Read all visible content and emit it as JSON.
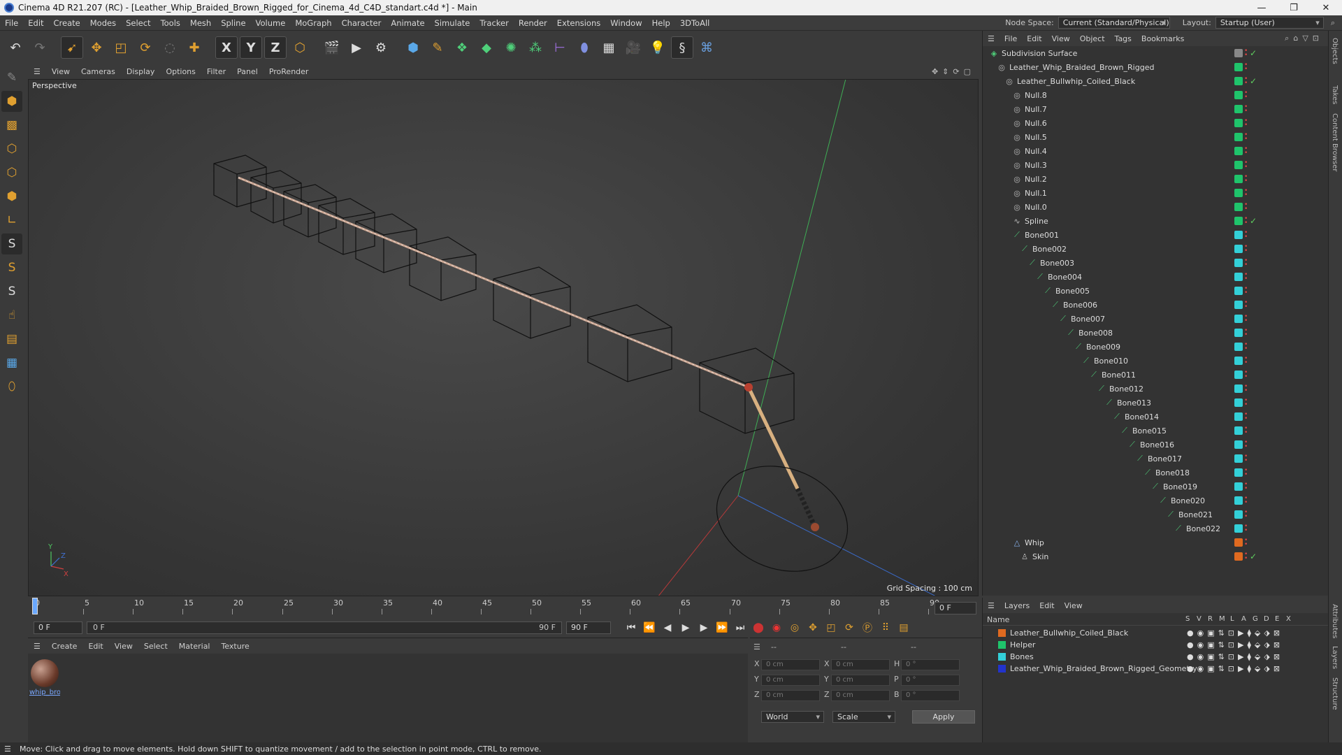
{
  "window": {
    "title": "Cinema 4D R21.207 (RC) - [Leather_Whip_Braided_Brown_Rigged_for_Cinema_4d_C4D_standart.c4d *] - Main",
    "minimize": "—",
    "maximize": "❐",
    "close": "✕"
  },
  "menubar": {
    "items": [
      "File",
      "Edit",
      "Create",
      "Modes",
      "Select",
      "Tools",
      "Mesh",
      "Spline",
      "Volume",
      "MoGraph",
      "Character",
      "Animate",
      "Simulate",
      "Tracker",
      "Render",
      "Extensions",
      "Window",
      "Help",
      "3DToAll"
    ],
    "node_space_label": "Node Space:",
    "node_space_value": "Current (Standard/Physical)",
    "layout_label": "Layout:",
    "layout_value": "Startup (User)"
  },
  "toolbar": {
    "icons": [
      "undo-icon",
      "redo-icon",
      "select-icon",
      "move-icon",
      "scale-icon",
      "rotate-icon",
      "live-select-icon",
      "create-icon",
      "x-axis-icon",
      "y-axis-icon",
      "z-axis-icon",
      "coordinate-system-icon",
      "render-view-icon",
      "render-picture-viewer-icon",
      "render-settings-icon",
      "cube-icon",
      "pen-icon",
      "subdivision-icon",
      "extrude-icon",
      "cloner-icon",
      "mograph-icon",
      "measure-icon",
      "deformer-icon",
      "floor-icon",
      "camera-icon",
      "light-icon",
      "spline-tool-icon",
      "python-icon"
    ],
    "axis_x": "X",
    "axis_y": "Y",
    "axis_z": "Z"
  },
  "viewport": {
    "menu": [
      "View",
      "Cameras",
      "Display",
      "Options",
      "Filter",
      "Panel",
      "ProRender"
    ],
    "label": "Perspective",
    "grid_spacing": "Grid Spacing : 100 cm",
    "axis_labels": {
      "y": "Y",
      "x": "X",
      "z": "Z"
    }
  },
  "timeline": {
    "ticks": [
      "0",
      "5",
      "10",
      "15",
      "20",
      "25",
      "30",
      "35",
      "40",
      "45",
      "50",
      "55",
      "60",
      "65",
      "70",
      "75",
      "80",
      "85",
      "90"
    ],
    "current_frame_display": "0 F",
    "start_field": "0 F",
    "range_start": "0 F",
    "range_end": "90 F",
    "end_field": "90 F"
  },
  "material_manager": {
    "menu": [
      "Create",
      "Edit",
      "View",
      "Select",
      "Material",
      "Texture"
    ],
    "materials": [
      {
        "name": "whip_bro"
      }
    ]
  },
  "coordinates": {
    "header_left": "--",
    "header_mid": "--",
    "header_right": "--",
    "rows": [
      {
        "axis": "X",
        "pos": "0 cm",
        "axis2": "X",
        "size": "0 cm",
        "axis3": "H",
        "rot": "0 °"
      },
      {
        "axis": "Y",
        "pos": "0 cm",
        "axis2": "Y",
        "size": "0 cm",
        "axis3": "P",
        "rot": "0 °"
      },
      {
        "axis": "Z",
        "pos": "0 cm",
        "axis2": "Z",
        "size": "0 cm",
        "axis3": "B",
        "rot": "0 °"
      }
    ],
    "mode": "World",
    "mode2": "Scale",
    "apply": "Apply"
  },
  "object_manager": {
    "menu": [
      "File",
      "Edit",
      "View",
      "Object",
      "Tags",
      "Bookmarks"
    ],
    "objects": [
      {
        "name": "Subdivision Surface",
        "indent": 0,
        "icon": "subdivision-icon",
        "color": "#888888",
        "check": true
      },
      {
        "name": "Leather_Whip_Braided_Brown_Rigged",
        "indent": 1,
        "icon": "null-icon",
        "color": "#1fc46b",
        "check": false
      },
      {
        "name": "Leather_Bullwhip_Coiled_Black",
        "indent": 2,
        "icon": "null-icon",
        "color": "#1fc46b",
        "check": true
      },
      {
        "name": "Null.8",
        "indent": 3,
        "icon": "null-icon",
        "color": "#1fc46b"
      },
      {
        "name": "Null.7",
        "indent": 3,
        "icon": "null-icon",
        "color": "#1fc46b"
      },
      {
        "name": "Null.6",
        "indent": 3,
        "icon": "null-icon",
        "color": "#1fc46b"
      },
      {
        "name": "Null.5",
        "indent": 3,
        "icon": "null-icon",
        "color": "#1fc46b"
      },
      {
        "name": "Null.4",
        "indent": 3,
        "icon": "null-icon",
        "color": "#1fc46b"
      },
      {
        "name": "Null.3",
        "indent": 3,
        "icon": "null-icon",
        "color": "#1fc46b"
      },
      {
        "name": "Null.2",
        "indent": 3,
        "icon": "null-icon",
        "color": "#1fc46b"
      },
      {
        "name": "Null.1",
        "indent": 3,
        "icon": "null-icon",
        "color": "#1fc46b"
      },
      {
        "name": "Null.0",
        "indent": 3,
        "icon": "null-icon",
        "color": "#1fc46b"
      },
      {
        "name": "Spline",
        "indent": 3,
        "icon": "spline-icon",
        "color": "#1fc46b",
        "check": true
      },
      {
        "name": "Bone001",
        "indent": 3,
        "icon": "bone-icon",
        "color": "#33d0d8"
      },
      {
        "name": "Bone002",
        "indent": 4,
        "icon": "bone-icon",
        "color": "#33d0d8"
      },
      {
        "name": "Bone003",
        "indent": 5,
        "icon": "bone-icon",
        "color": "#33d0d8"
      },
      {
        "name": "Bone004",
        "indent": 6,
        "icon": "bone-icon",
        "color": "#33d0d8"
      },
      {
        "name": "Bone005",
        "indent": 7,
        "icon": "bone-icon",
        "color": "#33d0d8"
      },
      {
        "name": "Bone006",
        "indent": 8,
        "icon": "bone-icon",
        "color": "#33d0d8"
      },
      {
        "name": "Bone007",
        "indent": 9,
        "icon": "bone-icon",
        "color": "#33d0d8"
      },
      {
        "name": "Bone008",
        "indent": 10,
        "icon": "bone-icon",
        "color": "#33d0d8"
      },
      {
        "name": "Bone009",
        "indent": 11,
        "icon": "bone-icon",
        "color": "#33d0d8"
      },
      {
        "name": "Bone010",
        "indent": 12,
        "icon": "bone-icon",
        "color": "#33d0d8"
      },
      {
        "name": "Bone011",
        "indent": 13,
        "icon": "bone-icon",
        "color": "#33d0d8"
      },
      {
        "name": "Bone012",
        "indent": 14,
        "icon": "bone-icon",
        "color": "#33d0d8"
      },
      {
        "name": "Bone013",
        "indent": 15,
        "icon": "bone-icon",
        "color": "#33d0d8"
      },
      {
        "name": "Bone014",
        "indent": 16,
        "icon": "bone-icon",
        "color": "#33d0d8"
      },
      {
        "name": "Bone015",
        "indent": 17,
        "icon": "bone-icon",
        "color": "#33d0d8"
      },
      {
        "name": "Bone016",
        "indent": 18,
        "icon": "bone-icon",
        "color": "#33d0d8"
      },
      {
        "name": "Bone017",
        "indent": 19,
        "icon": "bone-icon",
        "color": "#33d0d8"
      },
      {
        "name": "Bone018",
        "indent": 20,
        "icon": "bone-icon",
        "color": "#33d0d8"
      },
      {
        "name": "Bone019",
        "indent": 21,
        "icon": "bone-icon",
        "color": "#33d0d8"
      },
      {
        "name": "Bone020",
        "indent": 22,
        "icon": "bone-icon",
        "color": "#33d0d8"
      },
      {
        "name": "Bone021",
        "indent": 23,
        "icon": "bone-icon",
        "color": "#33d0d8"
      },
      {
        "name": "Bone022",
        "indent": 24,
        "icon": "bone-icon",
        "color": "#33d0d8"
      },
      {
        "name": "Whip",
        "indent": 3,
        "icon": "polygon-icon",
        "color": "#e06a20"
      },
      {
        "name": "Skin",
        "indent": 4,
        "icon": "skin-icon",
        "color": "#e06a20",
        "check": true
      }
    ]
  },
  "layers": {
    "menu": [
      "Layers",
      "Edit",
      "View"
    ],
    "header_name": "Name",
    "header_flags": [
      "S",
      "V",
      "R",
      "M",
      "L",
      "A",
      "G",
      "D",
      "E",
      "X"
    ],
    "items": [
      {
        "name": "Leather_Bullwhip_Coiled_Black",
        "color": "#e06a20"
      },
      {
        "name": "Helper",
        "color": "#1fc46b"
      },
      {
        "name": "Bones",
        "color": "#33d0d8"
      },
      {
        "name": "Leather_Whip_Braided_Brown_Rigged_Geometry",
        "color": "#2233cc"
      }
    ]
  },
  "right_tabs": [
    "Objects",
    "Takes",
    "Content Browser",
    "Attributes",
    "Layers",
    "Structure"
  ],
  "status": "Move: Click and drag to move elements. Hold down SHIFT to quantize movement / add to the selection in point mode, CTRL to remove."
}
